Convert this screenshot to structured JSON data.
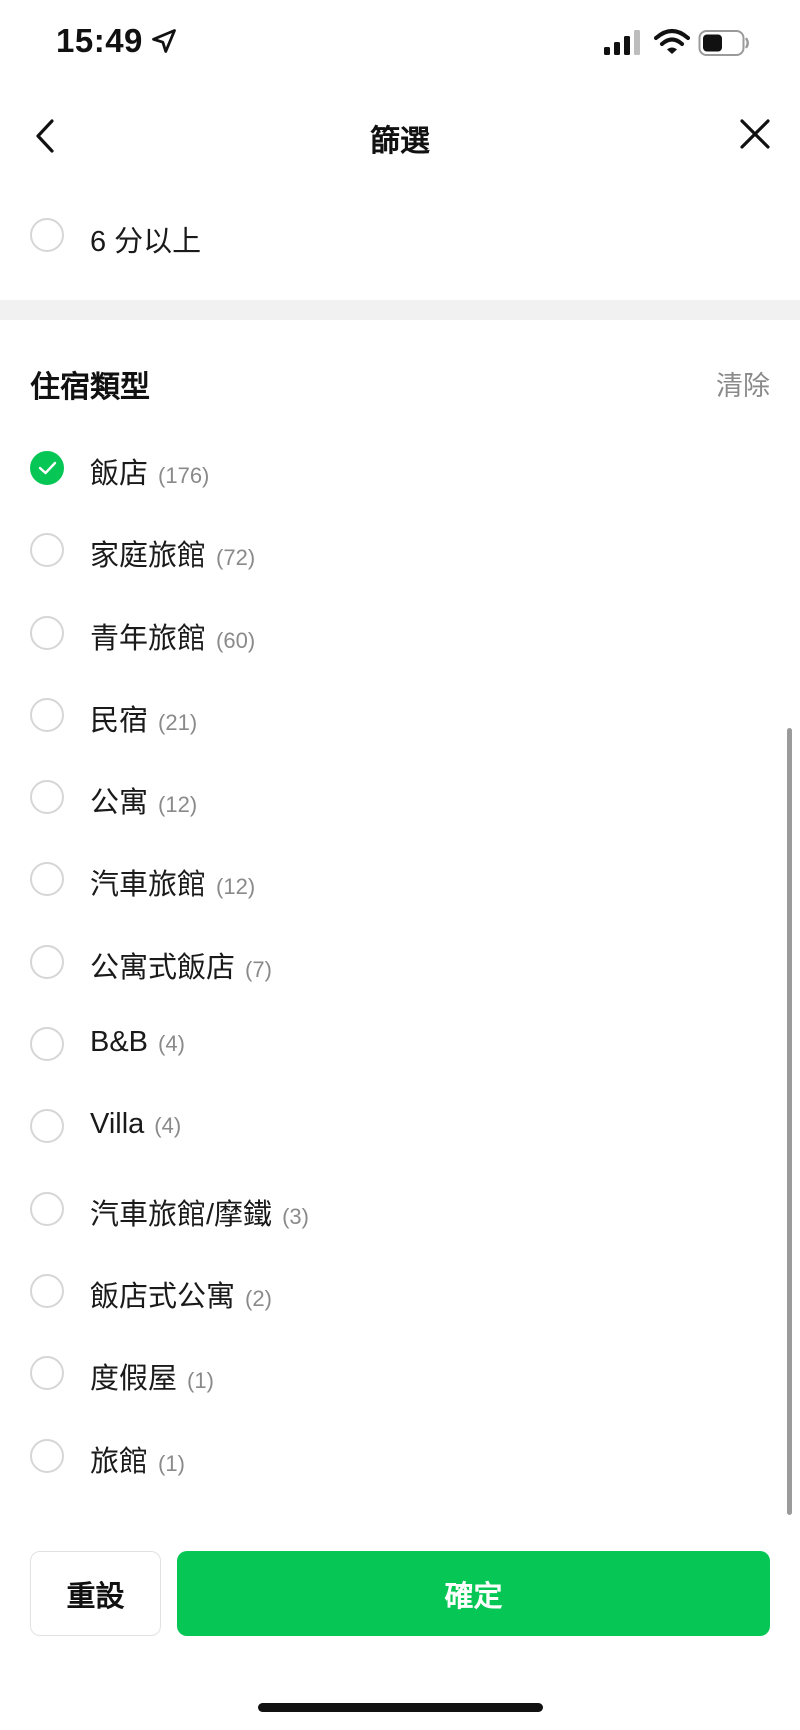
{
  "status_bar": {
    "time": "15:49",
    "icons": [
      "location-arrow-icon",
      "cellular-signal-icon",
      "wifi-icon",
      "battery-icon"
    ]
  },
  "header": {
    "title": "篩選",
    "back_icon": "chevron-left-icon",
    "close_icon": "close-icon"
  },
  "score_filter": {
    "label": "6 分以上",
    "checked": false
  },
  "accommodation": {
    "title": "住宿類型",
    "clear_label": "清除",
    "options": [
      {
        "label": "飯店",
        "count": "(176)",
        "checked": true
      },
      {
        "label": "家庭旅館",
        "count": "(72)",
        "checked": false
      },
      {
        "label": "青年旅館",
        "count": "(60)",
        "checked": false
      },
      {
        "label": "民宿",
        "count": "(21)",
        "checked": false
      },
      {
        "label": "公寓",
        "count": "(12)",
        "checked": false
      },
      {
        "label": "汽車旅館",
        "count": "(12)",
        "checked": false
      },
      {
        "label": "公寓式飯店",
        "count": "(7)",
        "checked": false
      },
      {
        "label": "B&B",
        "count": "(4)",
        "checked": false
      },
      {
        "label": "Villa",
        "count": "(4)",
        "checked": false
      },
      {
        "label": "汽車旅館/摩鐵",
        "count": "(3)",
        "checked": false
      },
      {
        "label": "飯店式公寓",
        "count": "(2)",
        "checked": false
      },
      {
        "label": "度假屋",
        "count": "(1)",
        "checked": false
      },
      {
        "label": "旅館",
        "count": "(1)",
        "checked": false
      }
    ]
  },
  "footer": {
    "reset_label": "重設",
    "confirm_label": "確定"
  },
  "colors": {
    "accent": "#06c755",
    "muted_text": "#8a8a8a",
    "divider": "#f1f1f1"
  }
}
